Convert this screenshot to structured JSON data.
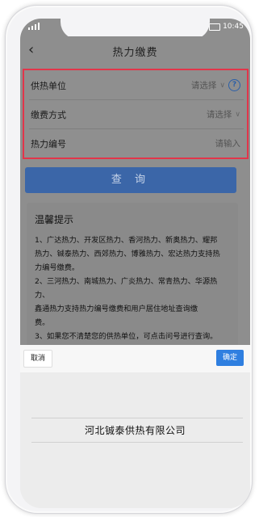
{
  "status": {
    "time": "10:45"
  },
  "header": {
    "title": "热力缴费",
    "back_icon": "chevron-left-icon"
  },
  "form": {
    "unit": {
      "label": "供热单位",
      "value": "请选择"
    },
    "method": {
      "label": "缴费方式",
      "value": "请选择"
    },
    "number": {
      "label": "热力编号",
      "placeholder": "请输入"
    }
  },
  "query_label": "查 询",
  "tips": {
    "title": "温馨提示",
    "lines": [
      "1、广达热力、开发区热力、香河热力、新奥热力、耀邦",
      "热力、铖泰热力、西郊热力、博雅热力、宏达热力支持热",
      "力编号缴费。",
      "2、三河热力、南城热力、广炎热力、常青热力、华源热力、",
      "鑫通热力支持热力编号缴费和用户居住地址查询缴",
      "费。",
      "3、如果您不清楚您的供热单位，可点击问号进行查询。"
    ]
  },
  "picker": {
    "cancel_label": "取消",
    "confirm_label": "确定",
    "options": [
      "河北铖泰供热有限公司"
    ]
  },
  "colors": {
    "highlight_border": "#e2354a",
    "primary_button": "#3b66a8",
    "confirm_button": "#2f7fe0"
  }
}
